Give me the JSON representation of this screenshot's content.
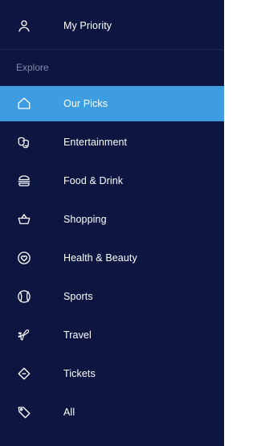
{
  "priority": {
    "label": "My Priority",
    "icon": "person-icon"
  },
  "section_title": "Explore",
  "colors": {
    "drawer_bg": "#0d1640",
    "active_bg": "#3d9de0",
    "section_text": "#7f8aa8"
  },
  "menu": [
    {
      "label": "Our Picks",
      "icon": "home-icon",
      "active": true
    },
    {
      "label": "Entertainment",
      "icon": "masks-icon",
      "active": false
    },
    {
      "label": "Food & Drink",
      "icon": "burger-icon",
      "active": false
    },
    {
      "label": "Shopping",
      "icon": "basket-icon",
      "active": false
    },
    {
      "label": "Health & Beauty",
      "icon": "heart-icon",
      "active": false
    },
    {
      "label": "Sports",
      "icon": "ball-icon",
      "active": false
    },
    {
      "label": "Travel",
      "icon": "plane-icon",
      "active": false
    },
    {
      "label": "Tickets",
      "icon": "ticket-icon",
      "active": false
    },
    {
      "label": "All",
      "icon": "tag-icon",
      "active": false
    }
  ]
}
